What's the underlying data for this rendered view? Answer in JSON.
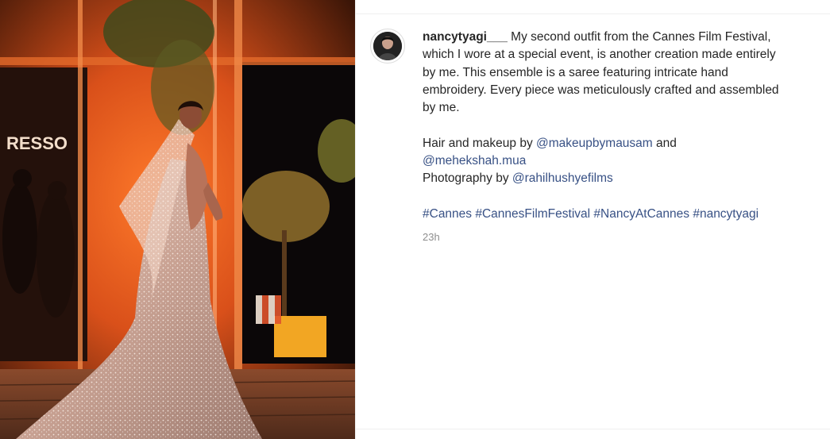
{
  "post": {
    "image_alt": "Woman in embellished saree on terrace at night",
    "image_brand_sign": "RESSO"
  },
  "comment": {
    "avatar_icon": "profile-avatar-icon",
    "username": "nancytyagi___",
    "caption_lines": [
      "My second outfit from the Cannes Film Festival,",
      "which I wore at a special event, is another creation made entirely",
      "by me. This ensemble is a saree featuring intricate hand",
      "embroidery. Every piece was meticulously crafted and assembled",
      "by me."
    ],
    "credits": {
      "hair_prefix": "Hair and makeup by ",
      "hair_mention_1": "@makeupbymausam",
      "hair_joiner": " and",
      "hair_mention_2": "@mehekshah.mua",
      "photo_prefix": "Photography by ",
      "photo_mention": "@rahilhushyefilms"
    },
    "hashtags": [
      "#Cannes",
      "#CannesFilmFestival",
      "#NancyAtCannes",
      "#nancytyagi"
    ],
    "timestamp": "23h"
  },
  "colors": {
    "text": "#262626",
    "link": "#385185",
    "muted": "#8e8e8e",
    "border": "#efefef"
  }
}
